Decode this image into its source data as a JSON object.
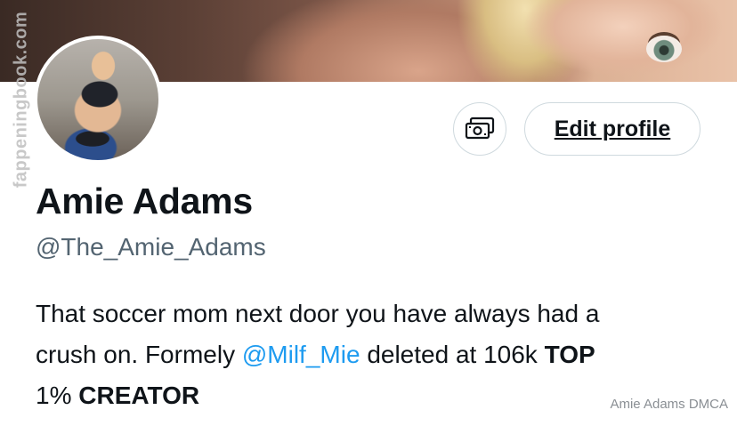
{
  "watermark": {
    "side_text": "fappeningbook.com"
  },
  "profile": {
    "display_name": "Amie Adams",
    "handle": "@The_Amie_Adams",
    "bio": {
      "line1_text": "That soccer mom next door you have always had a",
      "line2_prefix": "crush on. Formely",
      "mention": "@Milf_Mie",
      "line2_middle": "deleted at 106k",
      "strong_1": "TOP",
      "line3_prefix": "1%",
      "strong_2": "CREATOR"
    }
  },
  "actions": {
    "tip_icon": "money-icon",
    "edit_label": "Edit profile"
  },
  "footer": {
    "credit": "Amie Adams DMCA"
  },
  "colors": {
    "text": "#0f1419",
    "muted": "#536471",
    "link": "#1d9bf0",
    "border": "#cfd9de"
  }
}
